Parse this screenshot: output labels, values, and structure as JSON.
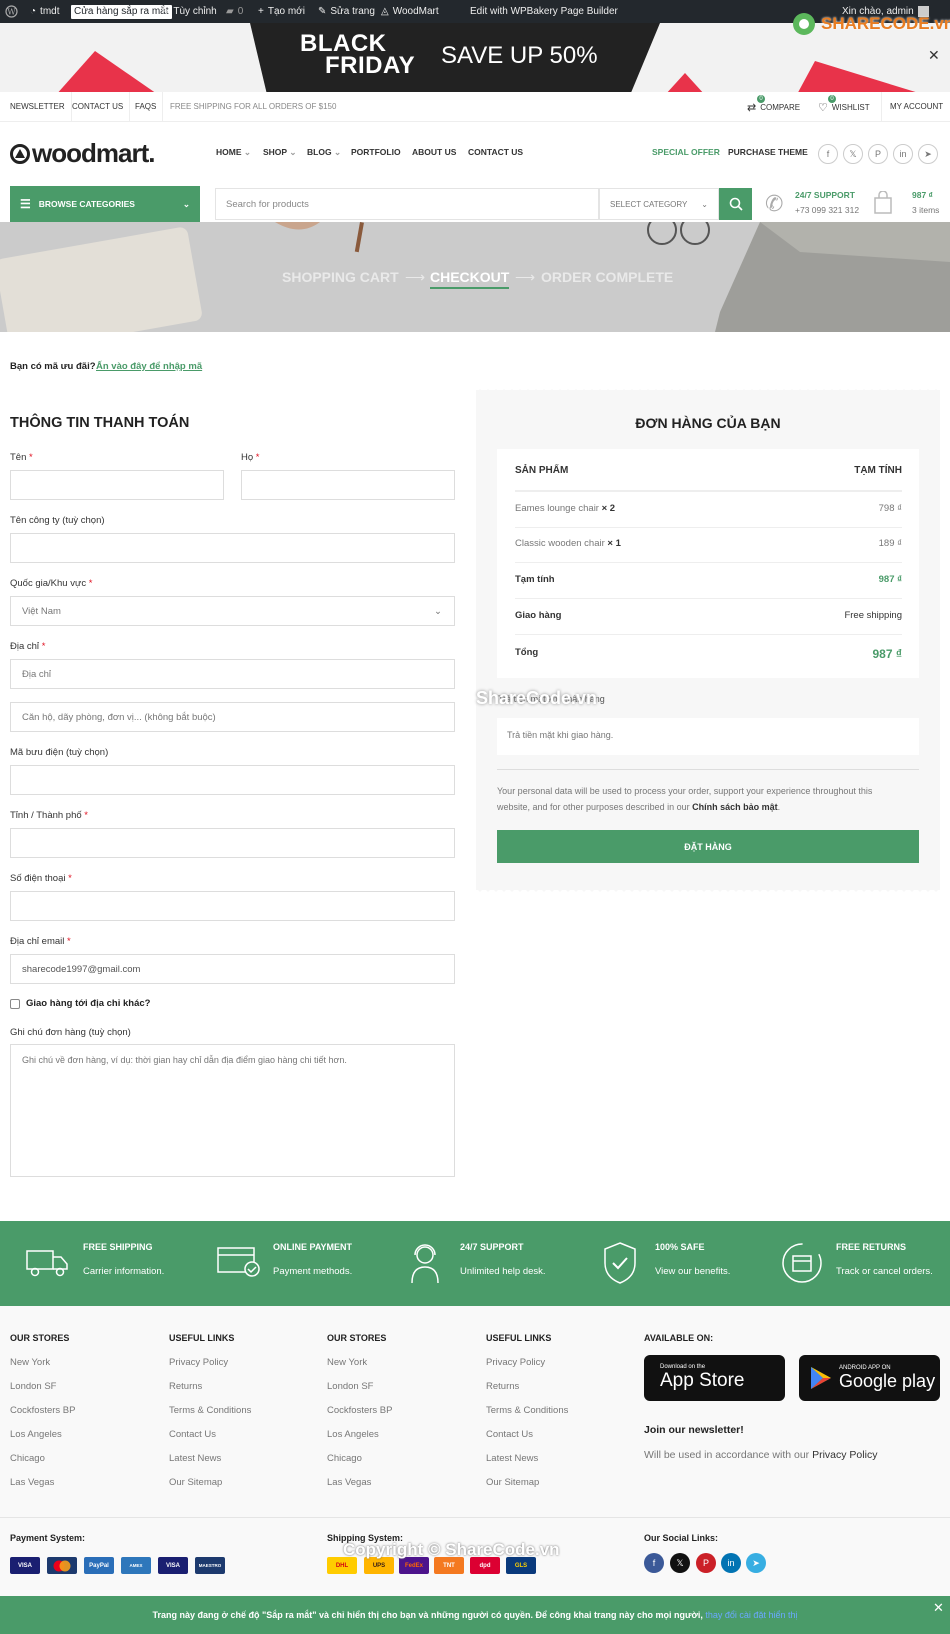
{
  "adminbar": {
    "site": "tmdt",
    "coming_soon": "Cửa hàng sắp ra mắt",
    "customize": "Tùy chỉnh",
    "comments": "0",
    "new": "Tạo mới",
    "edit": "Sửa trang",
    "woodmart": "WoodMart",
    "wpbakery": "Edit with WPBakery Page Builder",
    "greeting": "Xin chào, admin"
  },
  "promo": {
    "line1": "BLACK",
    "line2": "FRIDAY",
    "save": "SAVE UP 50%",
    "close": "✕"
  },
  "watermark_logo": "SHARECODE.vn",
  "topbar": {
    "links": [
      "NEWSLETTER",
      "CONTACT US",
      "FAQS"
    ],
    "shipping": "FREE SHIPPING FOR ALL ORDERS OF $150",
    "compare": "COMPARE",
    "wishlist": "WISHLIST",
    "account": "MY ACCOUNT",
    "compare_count": "0",
    "wishlist_count": "0"
  },
  "header": {
    "logo": "woodmart.",
    "nav": [
      "HOME",
      "SHOP",
      "BLOG",
      "PORTFOLIO",
      "ABOUT US",
      "CONTACT US"
    ],
    "special": "SPECIAL OFFER",
    "purchase": "PURCHASE THEME",
    "social_icons": [
      "facebook-icon",
      "x-icon",
      "pinterest-icon",
      "linkedin-icon",
      "telegram-icon"
    ]
  },
  "searchrow": {
    "browse": "BROWSE CATEGORIES",
    "placeholder": "Search for products",
    "select_category": "SELECT CATEGORY",
    "support_title": "24/7 SUPPORT",
    "support_phone": "+73 099 321 312",
    "cart_total": "987 ₫",
    "cart_items": "3 items"
  },
  "steps": {
    "cart": "SHOPPING CART",
    "checkout": "CHECKOUT",
    "complete": "ORDER COMPLETE"
  },
  "coupon": {
    "question": "Bạn có mã ưu đãi?",
    "link": "Ấn vào đây để nhập mã"
  },
  "billing": {
    "title": "THÔNG TIN THANH TOÁN",
    "first_name": "Tên",
    "last_name": "Họ",
    "company": "Tên công ty (tuỳ chọn)",
    "country": "Quốc gia/Khu vực",
    "country_value": "Việt Nam",
    "address": "Địa chỉ",
    "address_placeholder": "Địa chỉ",
    "address2_placeholder": "Căn hộ, dãy phòng, đơn vị... (không bắt buộc)",
    "postcode": "Mã bưu điện (tuỳ chọn)",
    "city": "Tỉnh / Thành phố",
    "phone": "Số điện thoại",
    "email": "Địa chỉ email",
    "email_value": "sharecode1997@gmail.com",
    "ship_other": "Giao hàng tới địa chỉ khác?",
    "notes": "Ghi chú đơn hàng (tuỳ chọn)",
    "notes_placeholder": "Ghi chú về đơn hàng, ví dụ: thời gian hay chỉ dẫn địa điểm giao hàng chi tiết hơn.",
    "required": "*"
  },
  "order": {
    "title": "ĐƠN HÀNG CỦA BẠN",
    "col_product": "SẢN PHẨM",
    "col_subtotal": "TẠM TÍNH",
    "items": [
      {
        "name": "Eames lounge chair",
        "qty": "× 2",
        "price": "798 ₫"
      },
      {
        "name": "Classic wooden chair",
        "qty": "× 1",
        "price": "189 ₫"
      }
    ],
    "subtotal_label": "Tạm tính",
    "subtotal": "987 ₫",
    "shipping_label": "Giao hàng",
    "shipping": "Free shipping",
    "total_label": "Tổng",
    "total": "987 ₫",
    "cod_label": "Trả tiền mặt khi nhận hàng",
    "cod_desc": "Trả tiền mặt khi giao hàng.",
    "privacy_text": "Your personal data will be used to process your order, support your experience throughout this website, and for other purposes described in our",
    "privacy_link": "Chính sách bảo mật",
    "place_order": "ĐẶT HÀNG"
  },
  "watermark_mid": "ShareCode.vn",
  "features": [
    {
      "title": "FREE SHIPPING",
      "sub": "Carrier information."
    },
    {
      "title": "ONLINE PAYMENT",
      "sub": "Payment methods."
    },
    {
      "title": "24/7 SUPPORT",
      "sub": "Unlimited help desk."
    },
    {
      "title": "100% SAFE",
      "sub": "View our benefits."
    },
    {
      "title": "FREE RETURNS",
      "sub": "Track or cancel orders."
    }
  ],
  "footer": {
    "stores_title": "OUR STORES",
    "links_title": "USEFUL LINKS",
    "stores": [
      "New York",
      "London SF",
      "Cockfosters BP",
      "Los Angeles",
      "Chicago",
      "Las Vegas"
    ],
    "links": [
      "Privacy Policy",
      "Returns",
      "Terms & Conditions",
      "Contact Us",
      "Latest News",
      "Our Sitemap"
    ],
    "available": "AVAILABLE ON:",
    "appstore_small": "Download on the",
    "appstore": "App Store",
    "gplay_small": "ANDROID APP ON",
    "gplay": "Google play",
    "newsletter": "Join our newsletter!",
    "newsletter_text": "Will be used in accordance with our",
    "newsletter_link": "Privacy Policy",
    "payment_title": "Payment System:",
    "payments": [
      "VISA",
      "MC",
      "PayPal",
      "AMEX",
      "VISA",
      "MAESTRO"
    ],
    "shipping_title": "Shipping System:",
    "carriers": [
      "DHL",
      "UPS",
      "FedEx",
      "TNT",
      "dpd",
      "GLS"
    ],
    "social_title": "Our Social Links:",
    "copyright": "Copyright © ShareCode.vn"
  },
  "notice": {
    "text": "Trang này đang ở chế độ \"Sắp ra mắt\" và chỉ hiển thị cho bạn và những người có quyền. Để công khai trang này cho mọi người,",
    "link": "thay đổi cài đặt hiển thị",
    "close": "✕"
  },
  "colors": {
    "accent": "#4a9b69",
    "admin": "#23282d",
    "banner": "#cbcbcb",
    "required": "#e01020"
  }
}
